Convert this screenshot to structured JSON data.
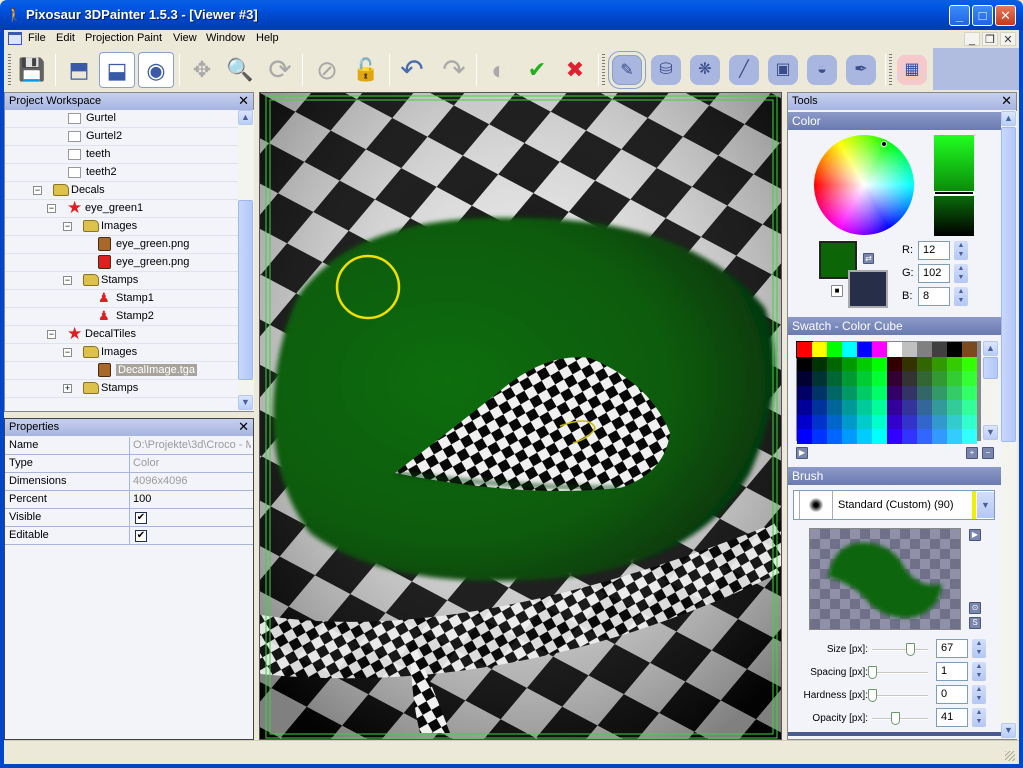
{
  "window": {
    "title": "Pixosaur 3DPainter 1.5.3 - [Viewer #3]",
    "app_icon": "app-dino-icon",
    "controls": {
      "minimize": "_",
      "maximize": "□",
      "close": "✕"
    },
    "mdi_controls": {
      "minimize": "_",
      "restore": "❐",
      "close": "✕"
    }
  },
  "menu": {
    "items": [
      "File",
      "Edit",
      "Projection Paint",
      "View",
      "Window",
      "Help"
    ]
  },
  "toolbar": {
    "buttons": [
      {
        "name": "save",
        "icon": "floppy-disk-icon",
        "glyph": "💾",
        "state": "normal"
      },
      {
        "name": "projection-box-open",
        "icon": "open-box-icon",
        "glyph": "⬒",
        "state": "normal"
      },
      {
        "name": "projection-box",
        "icon": "box-icon",
        "glyph": "⬓",
        "state": "active"
      },
      {
        "name": "projection-light",
        "icon": "light-bulb-icon",
        "glyph": "◉",
        "state": "active"
      },
      {
        "name": "move",
        "icon": "move-arrows-icon",
        "glyph": "✥",
        "state": "disabled"
      },
      {
        "name": "zoom",
        "icon": "magnifier-icon",
        "glyph": "🔍",
        "state": "disabled"
      },
      {
        "name": "rotate",
        "icon": "rotate-icon",
        "glyph": "⟳",
        "state": "disabled"
      },
      {
        "name": "hide",
        "icon": "eye-hidden-icon",
        "glyph": "⊘",
        "state": "disabled"
      },
      {
        "name": "lock",
        "icon": "padlock-open-icon",
        "glyph": "🔓",
        "state": "disabled"
      },
      {
        "name": "undo",
        "icon": "undo-arrow-icon",
        "glyph": "↶",
        "state": "normal"
      },
      {
        "name": "redo",
        "icon": "redo-arrow-icon",
        "glyph": "↷",
        "state": "disabled"
      },
      {
        "name": "layer",
        "icon": "sphere-layer-icon",
        "glyph": "◐",
        "state": "disabled"
      },
      {
        "name": "apply",
        "icon": "check-layer-icon",
        "glyph": "✔",
        "state": "normal"
      },
      {
        "name": "discard",
        "icon": "cross-layer-icon",
        "glyph": "✖",
        "state": "normal"
      }
    ],
    "paint_tools": [
      {
        "name": "brush",
        "icon": "brush-icon",
        "glyph": "✎",
        "state": "active"
      },
      {
        "name": "fill",
        "icon": "paint-bucket-icon",
        "glyph": "⛁",
        "state": "normal"
      },
      {
        "name": "clone",
        "icon": "clone-stamp-icon",
        "glyph": "❋",
        "state": "normal"
      },
      {
        "name": "line",
        "icon": "line-icon",
        "glyph": "╱",
        "state": "normal"
      },
      {
        "name": "stamp",
        "icon": "portrait-stamp-icon",
        "glyph": "▣",
        "state": "normal"
      },
      {
        "name": "smudge",
        "icon": "water-drop-icon",
        "glyph": "💧",
        "state": "normal"
      },
      {
        "name": "picker",
        "icon": "eyedropper-icon",
        "glyph": "✒",
        "state": "normal"
      }
    ],
    "grid_button": {
      "name": "grid",
      "icon": "grid-icon",
      "glyph": "▦"
    }
  },
  "workspace": {
    "title": "Project Workspace",
    "tree": [
      {
        "label": "Gurtel",
        "level": 4,
        "type": "checkbox"
      },
      {
        "label": "Gurtel2",
        "level": 4,
        "type": "checkbox"
      },
      {
        "label": "teeth",
        "level": 4,
        "type": "checkbox"
      },
      {
        "label": "teeth2",
        "level": 4,
        "type": "checkbox"
      },
      {
        "label": "Decals",
        "level": 1,
        "type": "folder",
        "expander": "−"
      },
      {
        "label": "eye_green1",
        "level": 2,
        "type": "star",
        "expander": "−"
      },
      {
        "label": "Images",
        "level": 3,
        "type": "folder",
        "expander": "−"
      },
      {
        "label": "eye_green.png",
        "level": 4,
        "type": "image-brown"
      },
      {
        "label": "eye_green.png",
        "level": 4,
        "type": "image-red"
      },
      {
        "label": "Stamps",
        "level": 3,
        "type": "folder",
        "expander": "−"
      },
      {
        "label": "Stamp1",
        "level": 4,
        "type": "stamp"
      },
      {
        "label": "Stamp2",
        "level": 4,
        "type": "stamp"
      },
      {
        "label": "DecalTiles",
        "level": 2,
        "type": "star",
        "expander": "−"
      },
      {
        "label": "Images",
        "level": 3,
        "type": "folder",
        "expander": "−"
      },
      {
        "label": "DecalImage.tga",
        "level": 4,
        "type": "image-brown",
        "selected": true
      },
      {
        "label": "Stamps",
        "level": 3,
        "type": "folder",
        "expander": "+"
      }
    ]
  },
  "properties": {
    "title": "Properties",
    "rows": [
      {
        "key": "Name",
        "value": "O:\\Projekte\\3d\\Croco - M",
        "muted": true
      },
      {
        "key": "Type",
        "value": "Color",
        "muted": true
      },
      {
        "key": "Dimensions",
        "value": "4096x4096",
        "muted": true
      },
      {
        "key": "Percent",
        "value": "100",
        "muted": false
      },
      {
        "key": "Visible",
        "checked": true
      },
      {
        "key": "Editable",
        "checked": true
      }
    ]
  },
  "tools": {
    "title": "Tools",
    "color": {
      "section_title": "Color",
      "foreground": "#0c6608",
      "background": "#262e48",
      "r_label": "R:",
      "g_label": "G:",
      "b_label": "B:",
      "r": "12",
      "g": "102",
      "b": "8"
    },
    "swatch": {
      "section_title": "Swatch - Color Cube",
      "top_row": [
        "#ff0000",
        "#ffff00",
        "#00ff00",
        "#00ffff",
        "#0000ff",
        "#ff00ff",
        "#ffffff",
        "#c0c0c0",
        "#808080",
        "#404040",
        "#000000",
        "#7a4a1e"
      ]
    },
    "brush": {
      "section_title": "Brush",
      "preset": "Standard (Custom) (90)",
      "sliders": [
        {
          "label": "Size [px]:",
          "value": "67",
          "fraction": 0.67
        },
        {
          "label": "Spacing [px]:",
          "value": "1",
          "fraction": 0.0
        },
        {
          "label": "Hardness [px]:",
          "value": "0",
          "fraction": 0.0
        },
        {
          "label": "Opacity [px]:",
          "value": "41",
          "fraction": 0.41
        }
      ]
    }
  },
  "viewport": {
    "paint_color": "#0c6608",
    "cursor_color": "#f0e000"
  }
}
